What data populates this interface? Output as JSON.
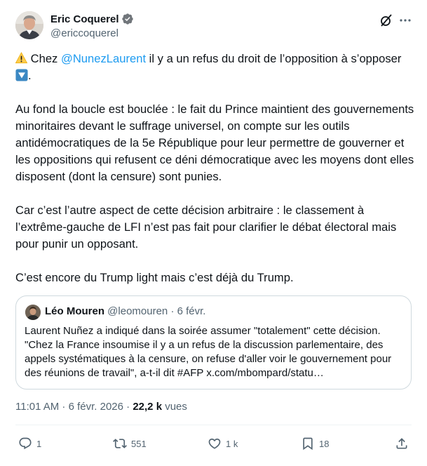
{
  "author": {
    "display_name": "Eric Coquerel",
    "handle": "@ericcoquerel"
  },
  "tweet": {
    "p1_before": " Chez ",
    "p1_mention": "@NunezLaurent",
    "p1_after": " il y a un refus du droit de l’opposition à s’opposer ",
    "p1_end": ".",
    "p2": "Au fond la boucle est bouclée : le fait du Prince maintient des gouvernements minoritaires devant le suffrage universel, on compte sur les outils antidémocratiques de la 5e République pour leur permettre de gouverner et les oppositions qui refusent ce déni démocratique avec les moyens dont elles disposent (dont la censure) sont punies.",
    "p3": "Car c’est l’autre aspect de cette décision arbitraire : le classement à l’extrême-gauche de LFI n’est pas fait pour clarifier le débat électoral mais pour punir un opposant.",
    "p4": "C’est encore du Trump light mais c’est déjà du Trump."
  },
  "quote": {
    "display_name": "Léo Mouren",
    "meta": " @leomouren · 6 févr.",
    "text": "Laurent Nuñez a indiqué dans la soirée assumer \"totalement\" cette décision. \"Chez la France insoumise il y a un refus de la discussion parlementaire, des appels systématiques à la censure, on refuse d'aller voir le gouvernement pour des réunions de travail\", a-t-il dit #AFP x.com/mbompard/statu…"
  },
  "timestamp": {
    "time_date": "11:01 AM · 6 févr. 2026 · ",
    "views_count": "22,2 k",
    "views_label": " vues"
  },
  "actions": {
    "replies": "1",
    "reposts": "551",
    "likes": "1 k",
    "bookmarks": "18"
  },
  "icons": {
    "verified": "verified-badge-icon",
    "grok": "grok-icon",
    "more": "more-icon",
    "warning": "warning-emoji-icon",
    "down": "down-arrow-emoji-icon",
    "reply": "reply-icon",
    "repost": "repost-icon",
    "like": "like-icon",
    "bookmark": "bookmark-icon",
    "share": "share-icon"
  },
  "colors": {
    "accent": "#1d9bf0",
    "text": "#0f1419",
    "secondary": "#536471",
    "border": "#cfd9de"
  }
}
